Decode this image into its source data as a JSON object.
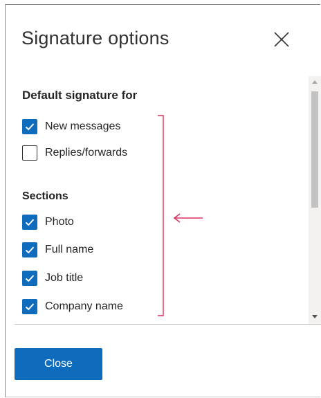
{
  "dialog": {
    "title": "Signature options",
    "close_icon": "close-icon"
  },
  "default_signature": {
    "heading": "Default signature for",
    "options": [
      {
        "label": "New messages",
        "checked": true
      },
      {
        "label": "Replies/forwards",
        "checked": false
      }
    ]
  },
  "sections": {
    "heading": "Sections",
    "options": [
      {
        "label": "Photo",
        "checked": true
      },
      {
        "label": "Full name",
        "checked": true
      },
      {
        "label": "Job title",
        "checked": true
      },
      {
        "label": "Company name",
        "checked": true
      }
    ]
  },
  "footer": {
    "close_label": "Close"
  },
  "colors": {
    "accent": "#0f6cbd",
    "annotation": "#d8315b"
  }
}
